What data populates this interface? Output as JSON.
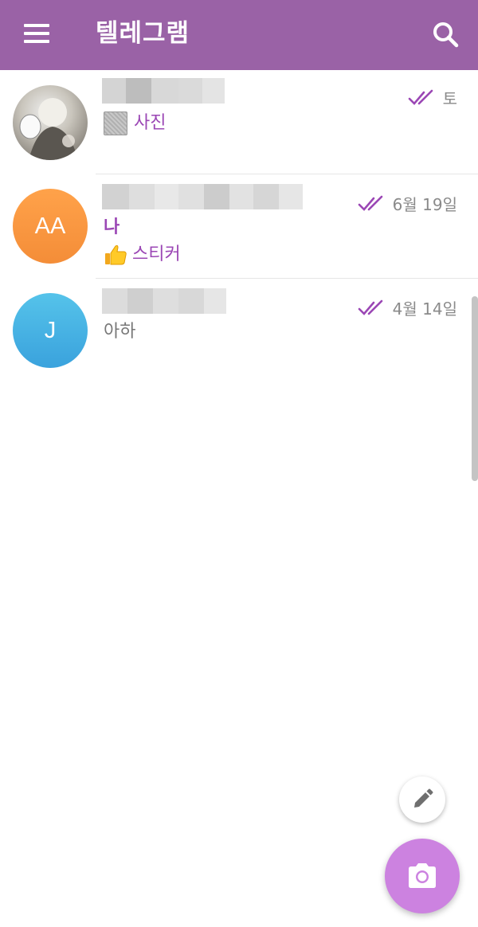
{
  "app": {
    "title": "텔레그램",
    "menu_icon": "menu-icon",
    "search_icon": "search-icon",
    "header_color": "#9a62a6",
    "accent_color": "#9b47b5"
  },
  "chats": [
    {
      "avatar": "photo",
      "avatar_icon": "profile-photo",
      "preview": "사진",
      "preview_icon": "photo-thumbnail-icon",
      "time": "토",
      "read_status": "double-check-icon"
    },
    {
      "avatar_initials": "AA",
      "avatar_color": "#f48d38",
      "sender": "나",
      "preview": "스티커",
      "preview_icon": "thumbs-up-icon",
      "time": "6월 19일",
      "read_status": "double-check-icon"
    },
    {
      "avatar_initials": "J",
      "avatar_color": "#3aa2dd",
      "preview": "아하",
      "time": "4월 14일",
      "read_status": "double-check-icon"
    }
  ],
  "fab": {
    "pencil_icon": "pencil-icon",
    "camera_icon": "camera-icon",
    "camera_color": "#cc82e0"
  }
}
